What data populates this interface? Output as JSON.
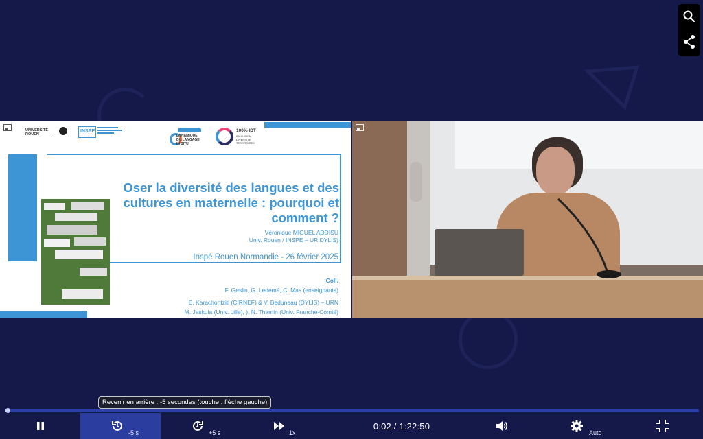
{
  "slide": {
    "title": "Oser la diversité des langues et des cultures en maternelle : pourquoi et comment ?",
    "author": "Véronique MIGUEL ADDISU",
    "affiliation": "Univ. Rouen / INSPE – UR DYLIS)",
    "event": "Inspé Rouen Normandie  - 26 février 2025",
    "coll_label": "Coll.",
    "coll_line1": "F. Geslin, G. Ledemé, C. Mas (enseignants)",
    "coll_line2": "E. Karachontziti (CIRNEF) & V. Beduneau (DYLIS) – URN",
    "coll_line3": "M. Jaskula (Univ. Lille), ), N. Thamin (Univ. Franche-Comté)",
    "logo_univ": "UNIVERSITÉ ROUEN",
    "logo_inspe": "INSPE",
    "logo_dylis_1": "DYNAMIQUE",
    "logo_dylis_2": "DU LANGAGE",
    "logo_dylis_3": "IN SITU",
    "logo_idt": "100% IDT",
    "logo_idt_sub": "INCLUSION DIVERSITÉ TERRITOIRES"
  },
  "tooltip": "Revenir en arrière : -5 secondes (touche : flèche gauche)",
  "playback": {
    "progress_fraction": 0.0004,
    "current_time": "0:02",
    "duration": "1:22:50",
    "time_display": "0:02 / 1:22:50",
    "rewind_label": "-5 s",
    "forward_label": "+5 s",
    "speed_label": "1x",
    "quality_label": "Auto"
  },
  "colors": {
    "background": "#15194a",
    "accent": "#2b3d9e",
    "slide_blue": "#3d95d6"
  },
  "icons": {
    "search": "search-icon",
    "share": "share-icon",
    "pause": "pause-icon",
    "rewind": "rewind-icon",
    "forward": "forward-icon",
    "speed": "fast-forward-icon",
    "volume": "volume-icon",
    "settings": "gear-icon",
    "fullscreen_exit": "exit-fullscreen-icon"
  }
}
